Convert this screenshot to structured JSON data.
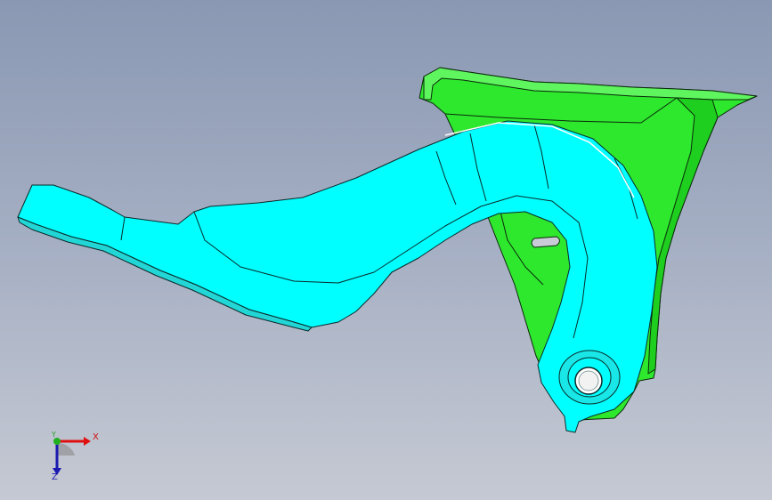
{
  "viewport": {
    "background_top": "#8a98b3",
    "background_bottom": "#c5c9d3"
  },
  "model": {
    "bracket_color": "#2ee82e",
    "arm_color": "#00ffff",
    "edge_color": "#0a2a2a"
  },
  "triad": {
    "x_label": "X",
    "y_label": "Y",
    "z_label": "Z",
    "x_color": "#e01010",
    "y_color": "#20b020",
    "z_color": "#1a1ab0"
  }
}
